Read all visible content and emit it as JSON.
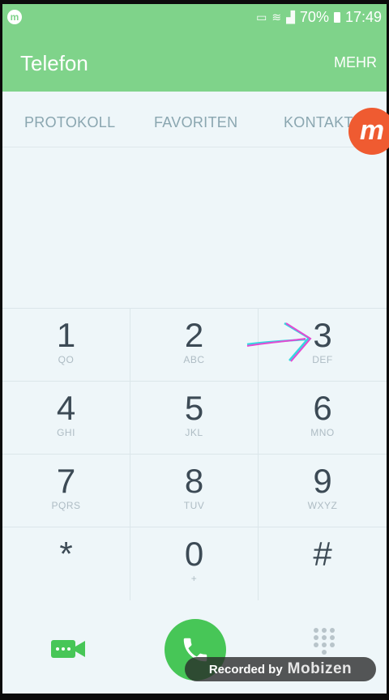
{
  "status_bar": {
    "notification_icon": "mobizen-icon",
    "cast_icon": "cast-icon",
    "wifi_icon": "wifi-icon",
    "signal_icon": "signal-icon",
    "battery_percent": "70%",
    "time": "17:49"
  },
  "app_bar": {
    "title": "Telefon",
    "more_label": "MEHR"
  },
  "tabs": [
    {
      "label": "PROTOKOLL"
    },
    {
      "label": "FAVORITEN"
    },
    {
      "label": "KONTAKTE"
    }
  ],
  "floating_badge": {
    "letter": "m"
  },
  "keypad": [
    {
      "digit": "1",
      "letters": "QO"
    },
    {
      "digit": "2",
      "letters": "ABC"
    },
    {
      "digit": "3",
      "letters": "DEF"
    },
    {
      "digit": "4",
      "letters": "GHI"
    },
    {
      "digit": "5",
      "letters": "JKL"
    },
    {
      "digit": "6",
      "letters": "MNO"
    },
    {
      "digit": "7",
      "letters": "PQRS"
    },
    {
      "digit": "8",
      "letters": "TUV"
    },
    {
      "digit": "9",
      "letters": "WXYZ"
    },
    {
      "digit": "*",
      "letters": ""
    },
    {
      "digit": "0",
      "letters": "+"
    },
    {
      "digit": "#",
      "letters": ""
    }
  ],
  "bottom_bar": {
    "video_icon": "video-call-icon",
    "call_icon": "phone-icon",
    "dialpad_icon": "dialpad-icon"
  },
  "recording": {
    "text": "Recorded by",
    "brand": "Mobizen"
  },
  "colors": {
    "header_green": "#7fd38a",
    "call_green": "#47c657",
    "badge_orange": "#ef5b31",
    "background": "#eef6f9"
  }
}
